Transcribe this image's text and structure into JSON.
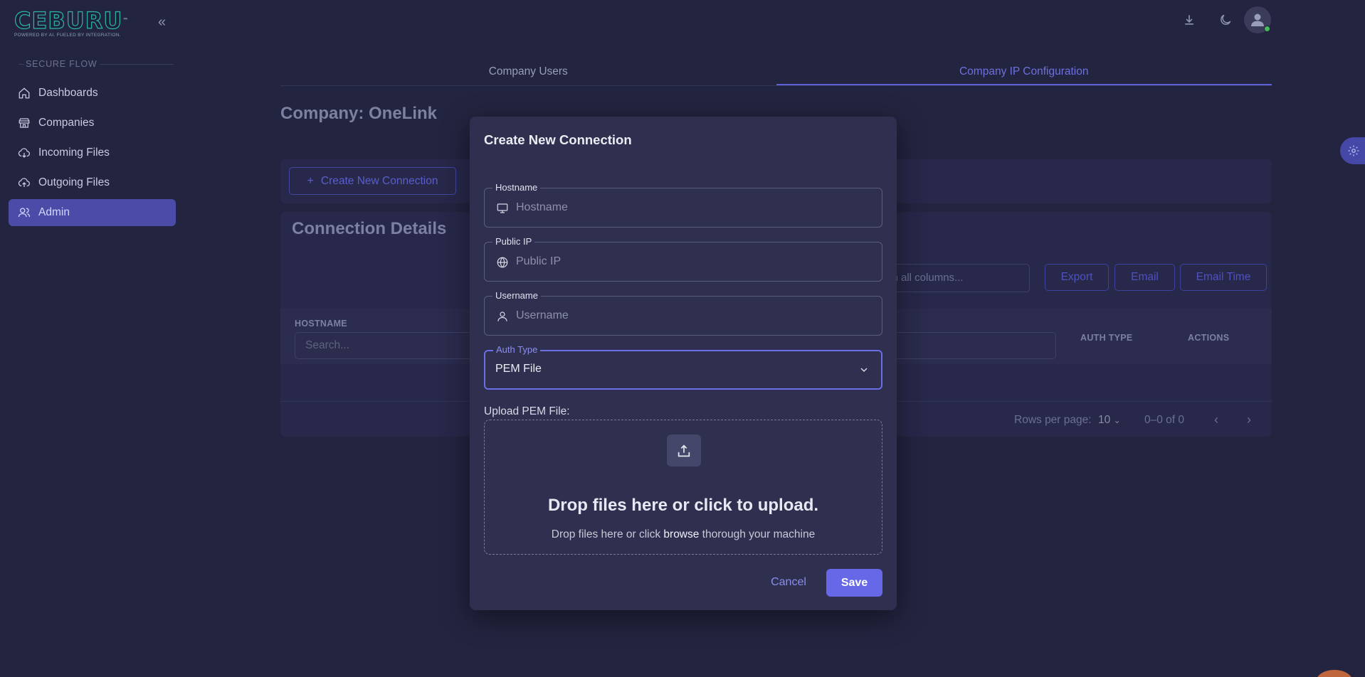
{
  "brand": {
    "logo_text": "CEBURU",
    "tagline": "POWERED BY AI. FUELED BY INTEGRATION.",
    "trademark": "™"
  },
  "sidebar": {
    "section_label": "SECURE FLOW",
    "items": [
      {
        "label": "Dashboards",
        "icon": "home-icon"
      },
      {
        "label": "Companies",
        "icon": "store-icon"
      },
      {
        "label": "Incoming Files",
        "icon": "cloud-download-icon"
      },
      {
        "label": "Outgoing Files",
        "icon": "cloud-upload-icon"
      },
      {
        "label": "Admin",
        "icon": "users-icon",
        "active": true
      }
    ]
  },
  "tabs": [
    {
      "label": "Company Users"
    },
    {
      "label": "Company IP Configuration",
      "active": true
    }
  ],
  "page": {
    "title": "Company: OneLink",
    "create_button": "Create New Connection",
    "create_button_icon": "+",
    "details_title": "Connection Details",
    "search_all_placeholder": "rch all columns...",
    "export_label": "Export",
    "email_label": "Email",
    "email_time_label": "Email Time"
  },
  "table": {
    "columns": [
      "HOSTNAME",
      "AUTH TYPE",
      "ACTIONS"
    ],
    "col_search_placeholder": "Search...",
    "rows_per_page_label": "Rows per page:",
    "rows_per_page_value": "10",
    "range_text": "0–0 of 0"
  },
  "modal": {
    "title": "Create New Connection",
    "hostname": {
      "label": "Hostname",
      "placeholder": "Hostname",
      "value": ""
    },
    "public_ip": {
      "label": "Public IP",
      "placeholder": "Public IP",
      "value": ""
    },
    "username": {
      "label": "Username",
      "placeholder": "Username",
      "value": ""
    },
    "auth_type": {
      "label": "Auth Type",
      "value": "PEM File"
    },
    "upload_label": "Upload PEM File:",
    "drop_title": "Drop files here or click to upload.",
    "drop_sub_prefix": "Drop files here or click ",
    "drop_sub_link": "browse",
    "drop_sub_suffix": " thorough your machine",
    "cancel_label": "Cancel",
    "save_label": "Save"
  },
  "colors": {
    "background": "#23243f",
    "modal": "#2f3050",
    "accent": "#6668e8",
    "active_nav": "#4a4ca8",
    "online": "#3fbf5a"
  }
}
